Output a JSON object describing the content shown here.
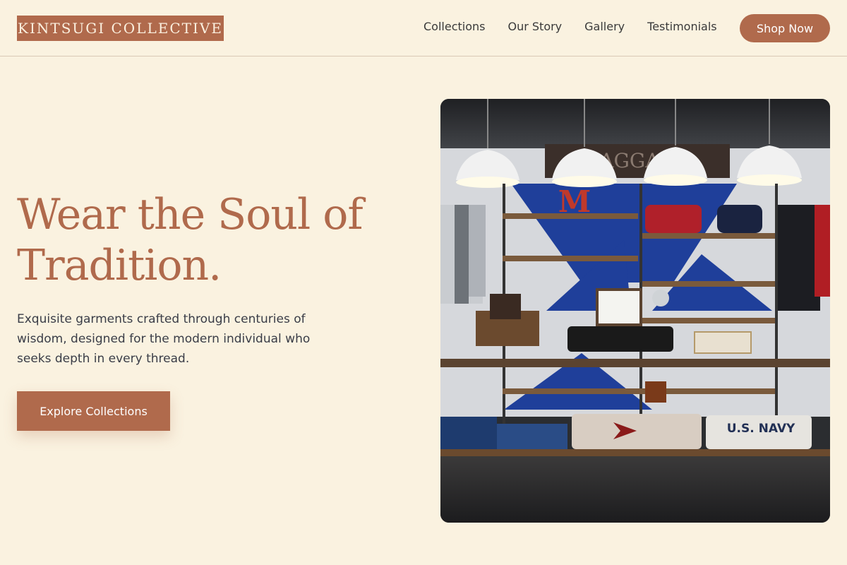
{
  "brand": {
    "name": "KINTSUGI COLLECTIVE"
  },
  "nav": {
    "links": [
      "Collections",
      "Our Story",
      "Gallery",
      "Testimonials"
    ],
    "cta_label": "Shop Now"
  },
  "hero": {
    "headline_line1": "Wear the Soul of",
    "headline_line2": "Tradition.",
    "description": "Exquisite garments crafted through centuries of wisdom, designed for the modern individual who seeks depth in every thread.",
    "cta_label": "Explore Collections",
    "image": {
      "sign_text": "BAGGAGE",
      "letter": "M",
      "sweater_text": "U.S. NAVY"
    }
  },
  "colors": {
    "accent": "#b06a4c",
    "background": "#faf2e0"
  }
}
